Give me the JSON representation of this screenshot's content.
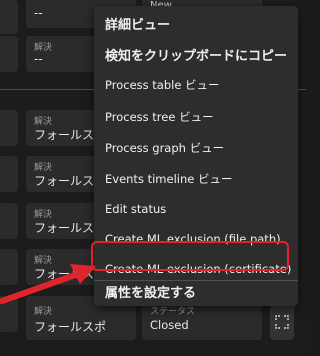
{
  "rows": {
    "r0": {
      "val_left": "--",
      "val_mid": "New"
    },
    "r1": {
      "label": "解決",
      "value": "--"
    },
    "r2": {
      "label": "解決",
      "value": "フォールスポ"
    },
    "r3": {
      "label": "解決",
      "value": "フォールスポ"
    },
    "r4": {
      "label": "解決",
      "value": "フォールスポ"
    },
    "r5": {
      "label": "解決",
      "value": "フォールスポ"
    },
    "r6": {
      "label": "解決",
      "value": "フォールスポ"
    },
    "r7": {
      "label": "解決",
      "value": "フォールスポ",
      "status_label": "ステータス",
      "status_value": "Closed"
    }
  },
  "menu": {
    "items": [
      "詳細ビュー",
      "検知をクリップボードにコピー",
      "Process table ビュー",
      "Process tree ビュー",
      "Process graph ビュー",
      "Events timeline ビュー",
      "Edit status",
      "Create ML exclusion (file path)",
      "Create ML exclusion (certificate)",
      "属性を設定する"
    ]
  },
  "icons": {
    "kebab": "⋮",
    "expand": "expand-icon"
  },
  "colors": {
    "highlight": "#e0242b",
    "arrow": "#e0242b"
  }
}
